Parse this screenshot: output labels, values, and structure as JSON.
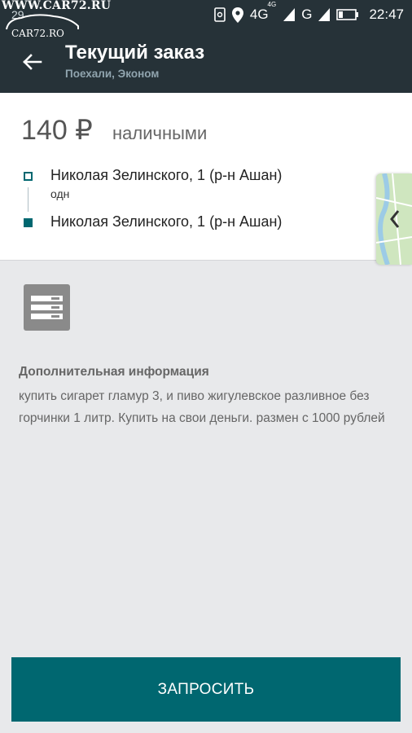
{
  "status_bar": {
    "watermark_url": "WWW.CAR72.RU",
    "watermark_logo": "CAR72.RO",
    "notification_count": "29",
    "network_1": "4G",
    "network_1_sup": "4G",
    "network_2": "G",
    "time": "22:47"
  },
  "toolbar": {
    "title": "Текущий заказ",
    "subtitle": "Поехали, Эконом"
  },
  "order": {
    "price": "140 ₽",
    "payment_method": "наличными",
    "from_address": "Николая Зелинского, 1 (р-н Ашан)",
    "from_note": "одн",
    "to_address": "Николая Зелинского, 1 (р-н Ашан)"
  },
  "extra_info": {
    "title": "Дополнительная информация",
    "text": "купить сигарет гламур 3, и пиво жигулевское разливное без горчинки 1 литр. Купить на свои деньги. размен с 1000 рублей"
  },
  "actions": {
    "request_label": "ЗАПРОСИТЬ"
  },
  "colors": {
    "toolbar_bg": "#263238",
    "accent": "#006770",
    "content_bg": "#e8e9eb"
  }
}
